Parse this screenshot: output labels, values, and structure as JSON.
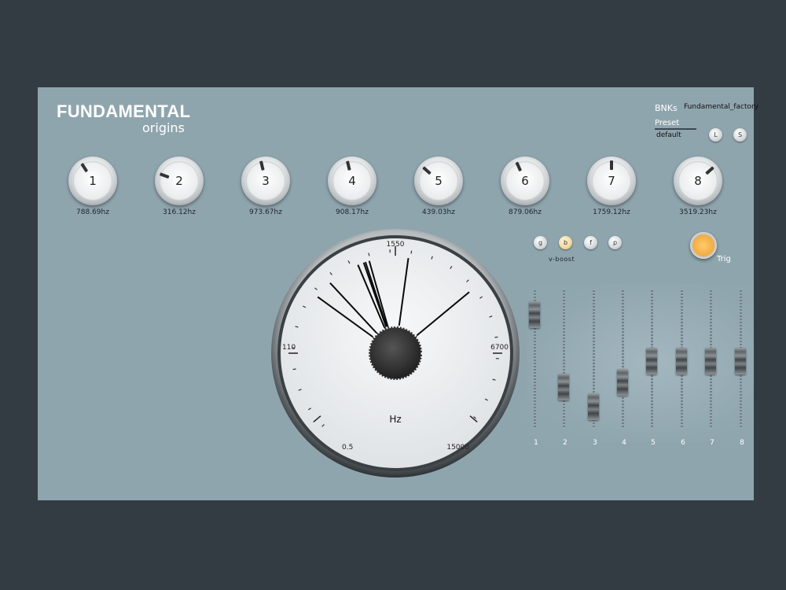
{
  "header": {
    "logo_main": "FUNDAMENTAL",
    "logo_sub": "origins",
    "bnks_label": "BNKs",
    "bnks_value": "Fundamental_factory",
    "preset_label": "Preset",
    "preset_value": "default",
    "load_button": "L",
    "save_button": "S"
  },
  "knobs": [
    {
      "label": "1",
      "freq": "788.69hz",
      "level": 0.38
    },
    {
      "label": "2",
      "freq": "316.12hz",
      "level": 0.24
    },
    {
      "label": "3",
      "freq": "973.67hz",
      "level": 0.45
    },
    {
      "label": "4",
      "freq": "908.17hz",
      "level": 0.45
    },
    {
      "label": "5",
      "freq": "439.03hz",
      "level": 0.32
    },
    {
      "label": "6",
      "freq": "879.06hz",
      "level": 0.41
    },
    {
      "label": "7",
      "freq": "1759.12hz",
      "level": 0.5
    },
    {
      "label": "8",
      "freq": "3519.23hz",
      "level": 0.68
    }
  ],
  "vboost": {
    "label": "v-boost",
    "buttons": [
      {
        "label": "g",
        "active": false
      },
      {
        "label": "b",
        "active": true
      },
      {
        "label": "f",
        "active": false
      },
      {
        "label": "p",
        "active": false
      }
    ]
  },
  "trig_label": "Trig",
  "gauge": {
    "unit": "Hz",
    "scale_labels": {
      "top": "1550",
      "left": "110",
      "right": "6700",
      "bottom_left": "0.5",
      "bottom_right": "15000"
    }
  },
  "faders": [
    {
      "label": "1",
      "level": 0.9
    },
    {
      "label": "2",
      "level": 0.25
    },
    {
      "label": "3",
      "level": 0.07
    },
    {
      "label": "4",
      "level": 0.29
    },
    {
      "label": "5",
      "level": 0.48
    },
    {
      "label": "6",
      "level": 0.48
    },
    {
      "label": "7",
      "level": 0.48
    },
    {
      "label": "8",
      "level": 0.48
    }
  ],
  "colors": {
    "panel": "#8fa5ae",
    "background": "#333b43",
    "accent": "#f2ac44"
  }
}
